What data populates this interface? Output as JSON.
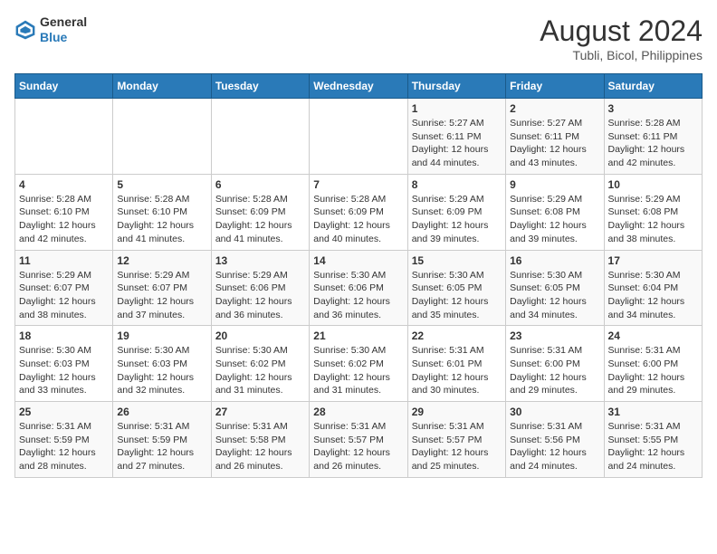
{
  "logo": {
    "line1": "General",
    "line2": "Blue"
  },
  "title": "August 2024",
  "subtitle": "Tubli, Bicol, Philippines",
  "days_of_week": [
    "Sunday",
    "Monday",
    "Tuesday",
    "Wednesday",
    "Thursday",
    "Friday",
    "Saturday"
  ],
  "weeks": [
    [
      {
        "day": "",
        "sunrise": "",
        "sunset": "",
        "daylight": ""
      },
      {
        "day": "",
        "sunrise": "",
        "sunset": "",
        "daylight": ""
      },
      {
        "day": "",
        "sunrise": "",
        "sunset": "",
        "daylight": ""
      },
      {
        "day": "",
        "sunrise": "",
        "sunset": "",
        "daylight": ""
      },
      {
        "day": "1",
        "sunrise": "Sunrise: 5:27 AM",
        "sunset": "Sunset: 6:11 PM",
        "daylight": "Daylight: 12 hours and 44 minutes."
      },
      {
        "day": "2",
        "sunrise": "Sunrise: 5:27 AM",
        "sunset": "Sunset: 6:11 PM",
        "daylight": "Daylight: 12 hours and 43 minutes."
      },
      {
        "day": "3",
        "sunrise": "Sunrise: 5:28 AM",
        "sunset": "Sunset: 6:11 PM",
        "daylight": "Daylight: 12 hours and 42 minutes."
      }
    ],
    [
      {
        "day": "4",
        "sunrise": "Sunrise: 5:28 AM",
        "sunset": "Sunset: 6:10 PM",
        "daylight": "Daylight: 12 hours and 42 minutes."
      },
      {
        "day": "5",
        "sunrise": "Sunrise: 5:28 AM",
        "sunset": "Sunset: 6:10 PM",
        "daylight": "Daylight: 12 hours and 41 minutes."
      },
      {
        "day": "6",
        "sunrise": "Sunrise: 5:28 AM",
        "sunset": "Sunset: 6:09 PM",
        "daylight": "Daylight: 12 hours and 41 minutes."
      },
      {
        "day": "7",
        "sunrise": "Sunrise: 5:28 AM",
        "sunset": "Sunset: 6:09 PM",
        "daylight": "Daylight: 12 hours and 40 minutes."
      },
      {
        "day": "8",
        "sunrise": "Sunrise: 5:29 AM",
        "sunset": "Sunset: 6:09 PM",
        "daylight": "Daylight: 12 hours and 39 minutes."
      },
      {
        "day": "9",
        "sunrise": "Sunrise: 5:29 AM",
        "sunset": "Sunset: 6:08 PM",
        "daylight": "Daylight: 12 hours and 39 minutes."
      },
      {
        "day": "10",
        "sunrise": "Sunrise: 5:29 AM",
        "sunset": "Sunset: 6:08 PM",
        "daylight": "Daylight: 12 hours and 38 minutes."
      }
    ],
    [
      {
        "day": "11",
        "sunrise": "Sunrise: 5:29 AM",
        "sunset": "Sunset: 6:07 PM",
        "daylight": "Daylight: 12 hours and 38 minutes."
      },
      {
        "day": "12",
        "sunrise": "Sunrise: 5:29 AM",
        "sunset": "Sunset: 6:07 PM",
        "daylight": "Daylight: 12 hours and 37 minutes."
      },
      {
        "day": "13",
        "sunrise": "Sunrise: 5:29 AM",
        "sunset": "Sunset: 6:06 PM",
        "daylight": "Daylight: 12 hours and 36 minutes."
      },
      {
        "day": "14",
        "sunrise": "Sunrise: 5:30 AM",
        "sunset": "Sunset: 6:06 PM",
        "daylight": "Daylight: 12 hours and 36 minutes."
      },
      {
        "day": "15",
        "sunrise": "Sunrise: 5:30 AM",
        "sunset": "Sunset: 6:05 PM",
        "daylight": "Daylight: 12 hours and 35 minutes."
      },
      {
        "day": "16",
        "sunrise": "Sunrise: 5:30 AM",
        "sunset": "Sunset: 6:05 PM",
        "daylight": "Daylight: 12 hours and 34 minutes."
      },
      {
        "day": "17",
        "sunrise": "Sunrise: 5:30 AM",
        "sunset": "Sunset: 6:04 PM",
        "daylight": "Daylight: 12 hours and 34 minutes."
      }
    ],
    [
      {
        "day": "18",
        "sunrise": "Sunrise: 5:30 AM",
        "sunset": "Sunset: 6:03 PM",
        "daylight": "Daylight: 12 hours and 33 minutes."
      },
      {
        "day": "19",
        "sunrise": "Sunrise: 5:30 AM",
        "sunset": "Sunset: 6:03 PM",
        "daylight": "Daylight: 12 hours and 32 minutes."
      },
      {
        "day": "20",
        "sunrise": "Sunrise: 5:30 AM",
        "sunset": "Sunset: 6:02 PM",
        "daylight": "Daylight: 12 hours and 31 minutes."
      },
      {
        "day": "21",
        "sunrise": "Sunrise: 5:30 AM",
        "sunset": "Sunset: 6:02 PM",
        "daylight": "Daylight: 12 hours and 31 minutes."
      },
      {
        "day": "22",
        "sunrise": "Sunrise: 5:31 AM",
        "sunset": "Sunset: 6:01 PM",
        "daylight": "Daylight: 12 hours and 30 minutes."
      },
      {
        "day": "23",
        "sunrise": "Sunrise: 5:31 AM",
        "sunset": "Sunset: 6:00 PM",
        "daylight": "Daylight: 12 hours and 29 minutes."
      },
      {
        "day": "24",
        "sunrise": "Sunrise: 5:31 AM",
        "sunset": "Sunset: 6:00 PM",
        "daylight": "Daylight: 12 hours and 29 minutes."
      }
    ],
    [
      {
        "day": "25",
        "sunrise": "Sunrise: 5:31 AM",
        "sunset": "Sunset: 5:59 PM",
        "daylight": "Daylight: 12 hours and 28 minutes."
      },
      {
        "day": "26",
        "sunrise": "Sunrise: 5:31 AM",
        "sunset": "Sunset: 5:59 PM",
        "daylight": "Daylight: 12 hours and 27 minutes."
      },
      {
        "day": "27",
        "sunrise": "Sunrise: 5:31 AM",
        "sunset": "Sunset: 5:58 PM",
        "daylight": "Daylight: 12 hours and 26 minutes."
      },
      {
        "day": "28",
        "sunrise": "Sunrise: 5:31 AM",
        "sunset": "Sunset: 5:57 PM",
        "daylight": "Daylight: 12 hours and 26 minutes."
      },
      {
        "day": "29",
        "sunrise": "Sunrise: 5:31 AM",
        "sunset": "Sunset: 5:57 PM",
        "daylight": "Daylight: 12 hours and 25 minutes."
      },
      {
        "day": "30",
        "sunrise": "Sunrise: 5:31 AM",
        "sunset": "Sunset: 5:56 PM",
        "daylight": "Daylight: 12 hours and 24 minutes."
      },
      {
        "day": "31",
        "sunrise": "Sunrise: 5:31 AM",
        "sunset": "Sunset: 5:55 PM",
        "daylight": "Daylight: 12 hours and 24 minutes."
      }
    ]
  ]
}
